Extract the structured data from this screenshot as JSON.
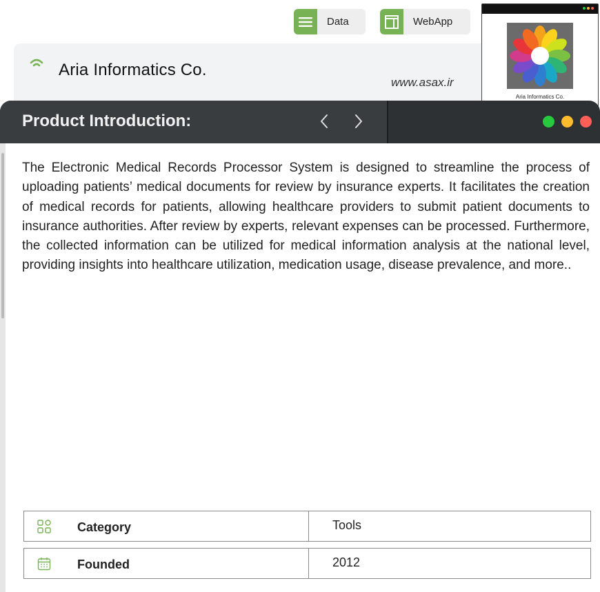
{
  "top_buttons": {
    "data_label": "Data",
    "webapp_label": "WebApp"
  },
  "header": {
    "company_name": "Aria Informatics Co.",
    "website": "www.asax.ir",
    "logo_caption": "Aria Informatics Co."
  },
  "title_bar": {
    "title": "Product Introduction:",
    "prev_glyph": "‹",
    "next_glyph": "›",
    "dot_colors": [
      "#27c93f",
      "#ffbd2e",
      "#ff5f56"
    ]
  },
  "content": {
    "description": "The Electronic Medical Records Processor System is designed to streamline the process of uploading patients’ medical documents for review by insurance experts. It facilitates the creation of medical records for patients, allowing healthcare providers to submit patient documents to insurance authorities. After review by experts, relevant expenses can be processed. Furthermore, the collected information can be utilized for medical information analysis at the national level, providing insights into healthcare utilization, medication usage, disease prevalence, and more.."
  },
  "info_table": [
    {
      "icon": "grid-icon",
      "label": "Category",
      "value": "Tools"
    },
    {
      "icon": "calendar-icon",
      "label": "Founded",
      "value": "2012"
    }
  ],
  "colors": {
    "accent_green": "#77b255",
    "title_bar_dark": "#2e3134",
    "header_band": "#f2f3f4"
  }
}
